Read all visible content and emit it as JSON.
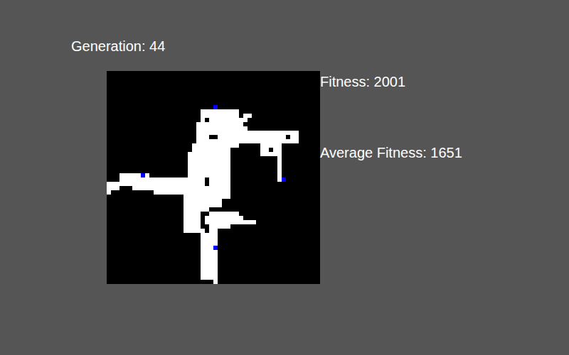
{
  "generation": {
    "label": "Generation: 44"
  },
  "stats": [
    {
      "label": "Fitness: 2001"
    },
    {
      "label": "Average Fitness: 1651"
    }
  ],
  "board": {
    "cols": 50,
    "rows": 50,
    "white_runs": [
      [
        9,
        22,
        30
      ],
      [
        10,
        22,
        30
      ],
      [
        10,
        32,
        33
      ],
      [
        11,
        22,
        22
      ],
      [
        11,
        24,
        32
      ],
      [
        12,
        21,
        31
      ],
      [
        13,
        21,
        32
      ],
      [
        14,
        21,
        44
      ],
      [
        15,
        21,
        23
      ],
      [
        15,
        26,
        41
      ],
      [
        15,
        43,
        44
      ],
      [
        16,
        21,
        44
      ],
      [
        17,
        20,
        30
      ],
      [
        17,
        36,
        39
      ],
      [
        17,
        40,
        40
      ],
      [
        18,
        20,
        28
      ],
      [
        18,
        36,
        37
      ],
      [
        18,
        39,
        39
      ],
      [
        18,
        40,
        40
      ],
      [
        19,
        19,
        28
      ],
      [
        19,
        36,
        39
      ],
      [
        19,
        40,
        40
      ],
      [
        20,
        19,
        28
      ],
      [
        20,
        40,
        40
      ],
      [
        21,
        19,
        28
      ],
      [
        21,
        40,
        40
      ],
      [
        22,
        19,
        28
      ],
      [
        22,
        40,
        40
      ],
      [
        23,
        19,
        28
      ],
      [
        23,
        40,
        40
      ],
      [
        24,
        3,
        9
      ],
      [
        24,
        19,
        28
      ],
      [
        24,
        40,
        40
      ],
      [
        25,
        3,
        22
      ],
      [
        25,
        24,
        28
      ],
      [
        25,
        40,
        40
      ],
      [
        26,
        0,
        22
      ],
      [
        26,
        24,
        28
      ],
      [
        27,
        0,
        2
      ],
      [
        27,
        6,
        28
      ],
      [
        28,
        0,
        0
      ],
      [
        28,
        11,
        28
      ],
      [
        29,
        18,
        28
      ],
      [
        30,
        18,
        26
      ],
      [
        31,
        18,
        26
      ],
      [
        32,
        18,
        23
      ],
      [
        33,
        18,
        21
      ],
      [
        33,
        24,
        30
      ],
      [
        34,
        18,
        21
      ],
      [
        34,
        23,
        31
      ],
      [
        35,
        18,
        21
      ],
      [
        35,
        23,
        34
      ],
      [
        36,
        18,
        21
      ],
      [
        36,
        24,
        28
      ],
      [
        37,
        18,
        21
      ],
      [
        37,
        22,
        22
      ],
      [
        37,
        24,
        25
      ],
      [
        38,
        22,
        25
      ],
      [
        39,
        22,
        25
      ],
      [
        40,
        22,
        25
      ],
      [
        41,
        22,
        25
      ],
      [
        42,
        22,
        25
      ],
      [
        43,
        22,
        25
      ],
      [
        44,
        22,
        25
      ],
      [
        45,
        22,
        25
      ],
      [
        46,
        22,
        25
      ],
      [
        47,
        22,
        25
      ],
      [
        48,
        22,
        25
      ],
      [
        49,
        25,
        25
      ]
    ],
    "blue_cells": [
      [
        8,
        25
      ],
      [
        24,
        8
      ],
      [
        25,
        41
      ],
      [
        41,
        25
      ]
    ]
  }
}
